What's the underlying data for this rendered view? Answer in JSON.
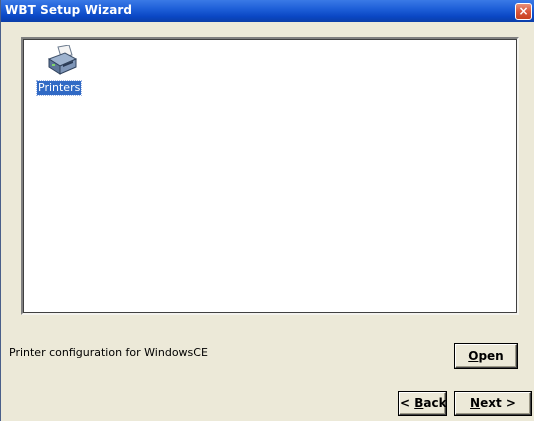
{
  "window": {
    "title": "WBT Setup Wizard",
    "close_glyph": "×"
  },
  "list": {
    "items": [
      {
        "label": "Printers",
        "icon": "printer-icon",
        "selected": true
      }
    ]
  },
  "description": "Printer configuration for WindowsCE",
  "buttons": {
    "open": {
      "mnemonic": "O",
      "rest": "pen"
    },
    "back": {
      "prefix": "< ",
      "mnemonic": "B",
      "rest": "ack"
    },
    "next": {
      "mnemonic": "N",
      "rest": "ext >"
    }
  },
  "colors": {
    "titlebar": "#0a47c4",
    "selection": "#316ac5",
    "close_button": "#d9573b",
    "dialog_face": "#ece9d8"
  }
}
